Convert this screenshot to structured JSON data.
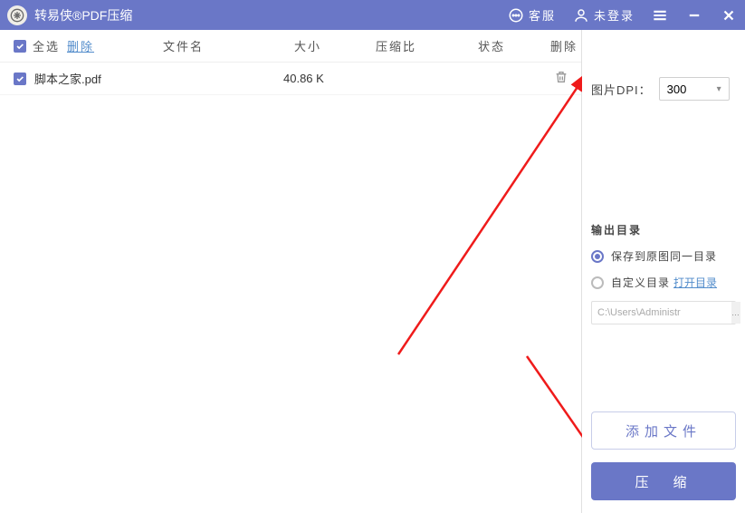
{
  "titlebar": {
    "app_title": "转易侠®PDF压缩",
    "service": "客服",
    "login": "未登录"
  },
  "list": {
    "header": {
      "select_all": "全选",
      "delete_link": "删除",
      "filename": "文件名",
      "size": "大小",
      "ratio": "压缩比",
      "status": "状态",
      "row_delete": "删除"
    },
    "rows": [
      {
        "filename": "脚本之家.pdf",
        "size": "40.86 K"
      }
    ]
  },
  "sidepanel": {
    "dpi_label": "图片DPI：",
    "dpi_value": "300",
    "outdir_title": "输出目录",
    "radio_same": "保存到原图同一目录",
    "radio_custom": "自定义目录",
    "open_dir": "打开目录",
    "path": "C:\\Users\\Administr",
    "add_file": "添加文件",
    "compress": "压　缩"
  }
}
